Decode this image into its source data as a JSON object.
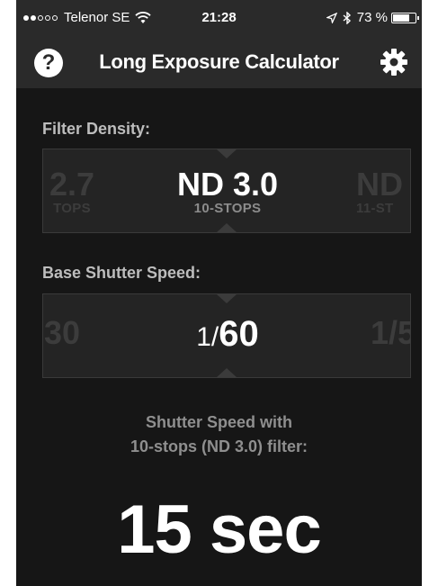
{
  "status_bar": {
    "carrier": "Telenor SE",
    "time": "21:28",
    "battery_text": "73 %",
    "battery_level": 0.73,
    "signal_dots_filled": 2,
    "signal_dots_total": 5
  },
  "nav": {
    "title": "Long Exposure Calculator",
    "help_label": "?",
    "help_icon": "help-icon",
    "settings_icon": "gear-icon"
  },
  "filter_density": {
    "label": "Filter Density:",
    "prev": {
      "main": "2.7",
      "sub": "TOPS"
    },
    "selected": {
      "main": "ND 3.0",
      "sub": "10-STOPS"
    },
    "next": {
      "main": "ND",
      "sub": "11-ST"
    }
  },
  "base_shutter": {
    "label": "Base Shutter Speed:",
    "prev": "30",
    "selected_num": "1/",
    "selected_den": "60",
    "next": "1/5"
  },
  "result": {
    "label_line1": "Shutter Speed with",
    "label_line2": "10-stops (ND 3.0) filter:",
    "value": "15 sec"
  },
  "colors": {
    "background": "#161616",
    "bar": "#2a2a2a",
    "picker_bg": "#242424",
    "label": "#bdbdbd",
    "text_primary": "#ffffff"
  }
}
